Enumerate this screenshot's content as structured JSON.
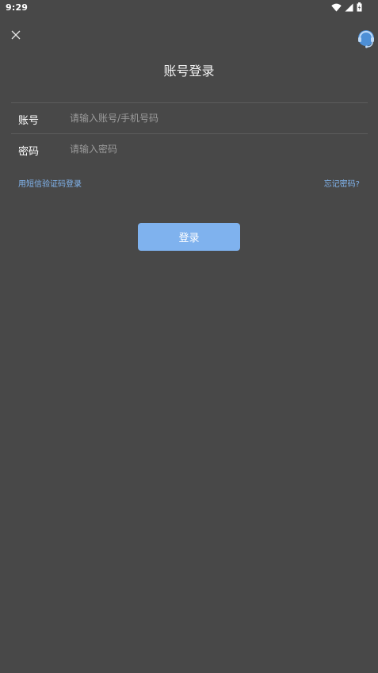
{
  "status_bar": {
    "time": "9:29",
    "icons": [
      "wifi-icon",
      "signal-icon",
      "battery-icon"
    ]
  },
  "header": {
    "title": "账号登录",
    "close_icon": "close-icon",
    "support_icon": "customer-service-icon"
  },
  "form": {
    "account": {
      "label": "账号",
      "placeholder": "请输入账号/手机号码",
      "value": ""
    },
    "password": {
      "label": "密码",
      "placeholder": "请输入密码",
      "value": ""
    }
  },
  "links": {
    "sms_login": "用短信验证码登录",
    "forgot_password": "忘记密码?"
  },
  "login_button": {
    "label": "登录"
  },
  "colors": {
    "background": "#484848",
    "accent": "#7fb2ee",
    "link": "#82b6f0",
    "divider": "#5c5c5c"
  }
}
